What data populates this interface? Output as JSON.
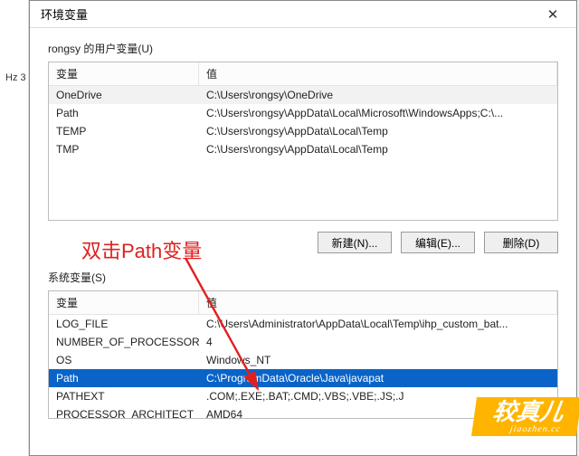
{
  "bg": {
    "hz": "Hz   3"
  },
  "dialog": {
    "title": "环境变量",
    "close": "✕",
    "userSection": {
      "label": "rongsy 的用户变量(U)",
      "headers": {
        "var": "变量",
        "val": "值"
      },
      "rows": [
        {
          "var": "OneDrive",
          "val": "C:\\Users\\rongsy\\OneDrive"
        },
        {
          "var": "Path",
          "val": "C:\\Users\\rongsy\\AppData\\Local\\Microsoft\\WindowsApps;C:\\..."
        },
        {
          "var": "TEMP",
          "val": "C:\\Users\\rongsy\\AppData\\Local\\Temp"
        },
        {
          "var": "TMP",
          "val": "C:\\Users\\rongsy\\AppData\\Local\\Temp"
        }
      ],
      "buttons": {
        "new": "新建(N)...",
        "edit": "编辑(E)...",
        "del": "删除(D)"
      }
    },
    "sysSection": {
      "label": "系统变量(S)",
      "headers": {
        "var": "变量",
        "val": "值"
      },
      "rows": [
        {
          "var": "LOG_FILE",
          "val": "C:\\Users\\Administrator\\AppData\\Local\\Temp\\ihp_custom_bat..."
        },
        {
          "var": "NUMBER_OF_PROCESSORS",
          "val": "4"
        },
        {
          "var": "OS",
          "val": "Windows_NT"
        },
        {
          "var": "Path",
          "val": "C:\\ProgramData\\Oracle\\Java\\javapat",
          "selected": true
        },
        {
          "var": "PATHEXT",
          "val": ".COM;.EXE;.BAT;.CMD;.VBS;.VBE;.JS;.J"
        },
        {
          "var": "PROCESSOR_ARCHITECT",
          "val": "AMD64"
        }
      ]
    }
  },
  "annotation": "双击Path变量",
  "watermark": {
    "big": "较真儿",
    "small": "jiaozhen.cc"
  }
}
